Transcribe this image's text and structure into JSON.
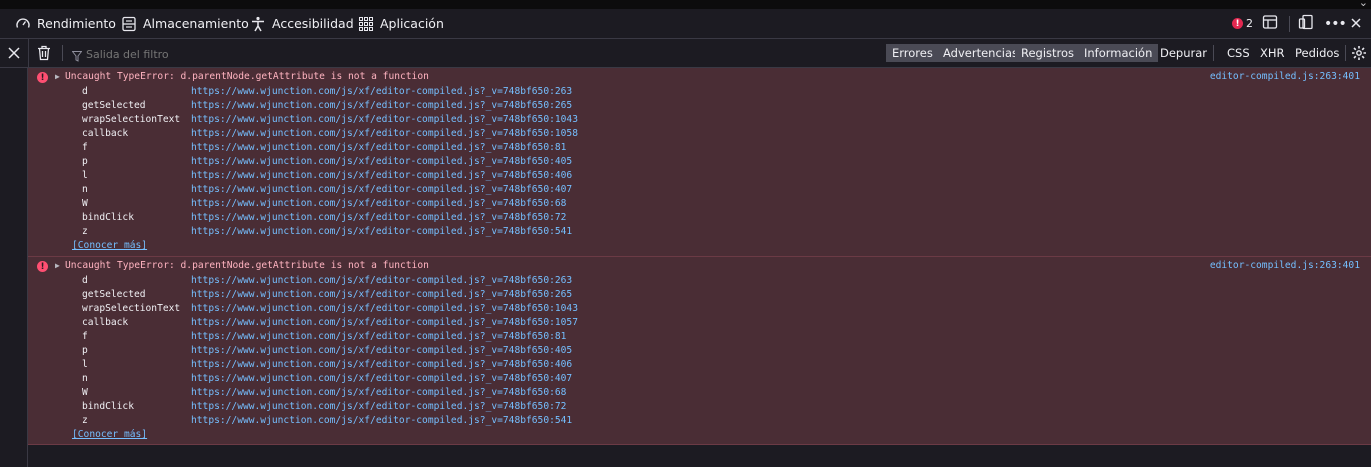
{
  "tabs": [
    {
      "label": "Rendimiento",
      "icon": "gauge-icon"
    },
    {
      "label": "Almacenamiento",
      "icon": "storage-icon"
    },
    {
      "label": "Accesibilidad",
      "icon": "accessibility-icon"
    },
    {
      "label": "Aplicación",
      "icon": "app-grid-icon"
    }
  ],
  "error_count": "2",
  "toolbar": {
    "filter_placeholder": "Salida del filtro",
    "buttons": [
      {
        "label": "Errores",
        "active": true
      },
      {
        "label": "Advertencias",
        "active": true
      },
      {
        "label": "Registros",
        "active": true
      },
      {
        "label": "Información",
        "active": true
      },
      {
        "label": "Depurar",
        "active": false
      },
      {
        "label": "CSS",
        "active": false
      },
      {
        "label": "XHR",
        "active": false
      },
      {
        "label": "Pedidos",
        "active": false
      }
    ]
  },
  "messages": [
    {
      "title": "Uncaught TypeError: d.parentNode.getAttribute is not a function",
      "source": "editor-compiled.js:263:401",
      "learn_more": "[Conocer más]",
      "frames": [
        {
          "fn": "d",
          "url": "https://www.wjunction.com/js/xf/editor-compiled.js?_v=748bf650:263"
        },
        {
          "fn": "getSelected",
          "url": "https://www.wjunction.com/js/xf/editor-compiled.js?_v=748bf650:265"
        },
        {
          "fn": "wrapSelectionText",
          "url": "https://www.wjunction.com/js/xf/editor-compiled.js?_v=748bf650:1043"
        },
        {
          "fn": "callback",
          "url": "https://www.wjunction.com/js/xf/editor-compiled.js?_v=748bf650:1058"
        },
        {
          "fn": "f",
          "url": "https://www.wjunction.com/js/xf/editor-compiled.js?_v=748bf650:81"
        },
        {
          "fn": "p",
          "url": "https://www.wjunction.com/js/xf/editor-compiled.js?_v=748bf650:405"
        },
        {
          "fn": "l",
          "url": "https://www.wjunction.com/js/xf/editor-compiled.js?_v=748bf650:406"
        },
        {
          "fn": "n",
          "url": "https://www.wjunction.com/js/xf/editor-compiled.js?_v=748bf650:407"
        },
        {
          "fn": "W",
          "url": "https://www.wjunction.com/js/xf/editor-compiled.js?_v=748bf650:68"
        },
        {
          "fn": "bindClick",
          "url": "https://www.wjunction.com/js/xf/editor-compiled.js?_v=748bf650:72"
        },
        {
          "fn": "z",
          "url": "https://www.wjunction.com/js/xf/editor-compiled.js?_v=748bf650:541"
        }
      ]
    },
    {
      "title": "Uncaught TypeError: d.parentNode.getAttribute is not a function",
      "source": "editor-compiled.js:263:401",
      "learn_more": "[Conocer más]",
      "frames": [
        {
          "fn": "d",
          "url": "https://www.wjunction.com/js/xf/editor-compiled.js?_v=748bf650:263"
        },
        {
          "fn": "getSelected",
          "url": "https://www.wjunction.com/js/xf/editor-compiled.js?_v=748bf650:265"
        },
        {
          "fn": "wrapSelectionText",
          "url": "https://www.wjunction.com/js/xf/editor-compiled.js?_v=748bf650:1043"
        },
        {
          "fn": "callback",
          "url": "https://www.wjunction.com/js/xf/editor-compiled.js?_v=748bf650:1057"
        },
        {
          "fn": "f",
          "url": "https://www.wjunction.com/js/xf/editor-compiled.js?_v=748bf650:81"
        },
        {
          "fn": "p",
          "url": "https://www.wjunction.com/js/xf/editor-compiled.js?_v=748bf650:405"
        },
        {
          "fn": "l",
          "url": "https://www.wjunction.com/js/xf/editor-compiled.js?_v=748bf650:406"
        },
        {
          "fn": "n",
          "url": "https://www.wjunction.com/js/xf/editor-compiled.js?_v=748bf650:407"
        },
        {
          "fn": "W",
          "url": "https://www.wjunction.com/js/xf/editor-compiled.js?_v=748bf650:68"
        },
        {
          "fn": "bindClick",
          "url": "https://www.wjunction.com/js/xf/editor-compiled.js?_v=748bf650:72"
        },
        {
          "fn": "z",
          "url": "https://www.wjunction.com/js/xf/editor-compiled.js?_v=748bf650:541"
        }
      ]
    }
  ]
}
